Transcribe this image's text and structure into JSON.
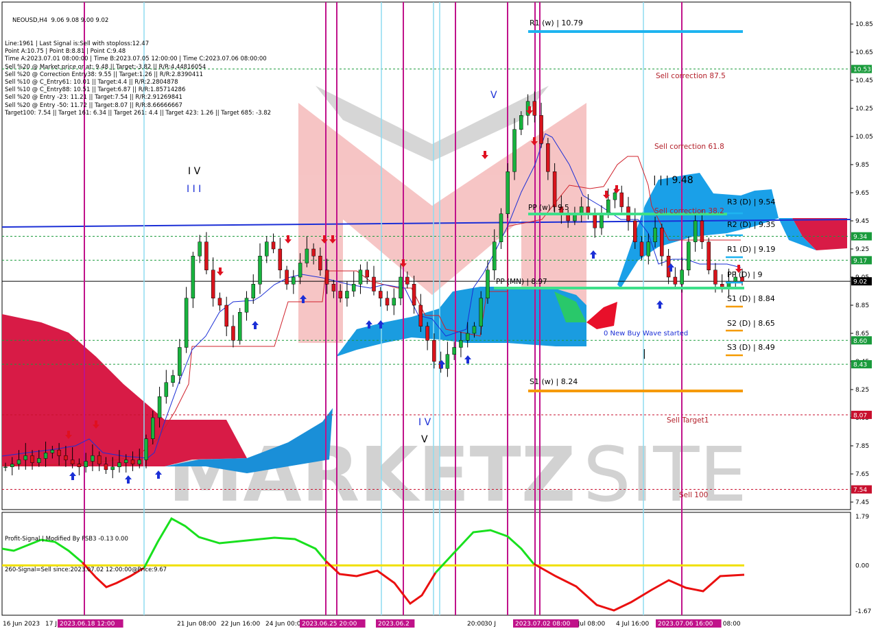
{
  "symbol_header": "NEOUSD,H4  9.06 9.08 9.00 9.02",
  "info_lines": [
    "Line:1961 | Last Signal is:Sell with stoploss:12.47",
    "Point A:10.75 | Point B:8.81 | Point C:9.48",
    "Time A:2023.07.01 08:00:00 | Time B:2023.07.05 12:00:00 | Time C:2023.07.06 08:00:00",
    "Sell %20 @ Market price or at: 9.48 || Target:-3.82 || R/R:4.44816054",
    "Sell %20 @ Correction Entry38: 9.55 || Target:1.26 || R/R:2.8390411",
    "Sell %10 @ C_Entry61: 10.01 || Target:4.4 || R/R:2.2804878",
    "Sell %10 @ C_Entry88: 10.51 || Target:6.87 || R/R:1.85714286",
    "Sell %20 @ Entry -23: 11.21 || Target:7.54 || R/R:2.91269841",
    "Sell %20 @ Entry -50: 11.72 || Target:8.07 || R/R:8.66666667",
    "Target100: 7.54 || Target 161: 6.34 || Target 261: 4.4 || Target 423: 1.26 || Target 685: -3.82"
  ],
  "watermark": "MARKETZ|SITE",
  "levels": [
    {
      "label": "R1 (w) | 10.79",
      "value": 10.79,
      "color": "#1eb4f0"
    },
    {
      "label": "R3 (D) | 9.54",
      "value": 9.54,
      "color": "#1eb4f0"
    },
    {
      "label": "R2 (D) | 9.35",
      "value": 9.35,
      "color": "#1eb4f0"
    },
    {
      "label": "R1 (D) | 9.19",
      "value": 9.19,
      "color": "#1eb4f0"
    },
    {
      "label": "PP (D) | 9",
      "value": 9.0,
      "color": "#1eb4f0"
    },
    {
      "label": "S1 (D) | 8.84",
      "value": 8.84,
      "color": "#f59a00"
    },
    {
      "label": "S2 (D) | 8.65",
      "value": 8.65,
      "color": "#f59a00"
    },
    {
      "label": "S3 (D) | 8.49",
      "value": 8.49,
      "color": "#f59a00"
    },
    {
      "label": "S1 (w) | 8.24",
      "value": 8.24,
      "color": "#f59a00"
    }
  ],
  "annotations": {
    "sell_correction_875": "Sell correction 87.5",
    "sell_correction_618": "Sell correction 61.8",
    "sell_correction_382": "Sell correction 38.2",
    "sell_target1": "Sell Target1",
    "sell_100": "Sell 100",
    "pp_mn": "PP (MN) | 8.97",
    "pp_w": "PP (w) | 9.5",
    "new_buy_wave": "0 New Buy Wave started",
    "wave_iii_value": "| | | 9.48",
    "wave_iv_left": "I V",
    "wave_iii_left": "I I I",
    "wave_iv_mid": "I V",
    "wave_v_mid": "V",
    "wave_v_top": "V",
    "wave_bar": "|"
  },
  "price_axis": {
    "ticks": [
      "10.85",
      "10.65",
      "10.45",
      "10.25",
      "10.05",
      "9.85",
      "9.65",
      "9.45",
      "9.25",
      "9.05",
      "8.85",
      "8.65",
      "8.45",
      "8.25",
      "8.05",
      "7.85",
      "7.65",
      "7.45"
    ],
    "badges": [
      {
        "text": "10.53",
        "value": 10.53,
        "color": "#1a9b3c"
      },
      {
        "text": "9.34",
        "value": 9.34,
        "color": "#1a9b3c"
      },
      {
        "text": "9.17",
        "value": 9.17,
        "color": "#1a9b3c"
      },
      {
        "text": "9.02",
        "value": 9.02,
        "color": "#000000"
      },
      {
        "text": "8.60",
        "value": 8.6,
        "color": "#1a9b3c"
      },
      {
        "text": "8.43",
        "value": 8.43,
        "color": "#1a9b3c"
      },
      {
        "text": "8.07",
        "value": 8.07,
        "color": "#c8102e"
      },
      {
        "text": "7.54",
        "value": 7.54,
        "color": "#c8102e"
      }
    ]
  },
  "time_axis": {
    "labels": [
      "16 Jun 2023",
      "17 J",
      "21 Jun 08:00",
      "22 Jun 16:00",
      "24 Jun 00:00",
      "30 J",
      "3 Jul 08:00",
      "4 Jul 16:00",
      "Jul 08:00",
      "6",
      "20:00"
    ],
    "highlights": [
      "2023.06.18 12:00",
      "2023.06.25 20:00",
      "2023.06.2",
      "2023.07.02 08:00",
      "2023.07.06 16:00"
    ]
  },
  "subwindow": {
    "title": "Profit-Signal | Modified By FSB3 -0.13 0.00",
    "signal_text": "260-Signal=Sell since:2023.07.02 12:00:00@Price:9.67",
    "ticks": [
      "1.79",
      "0.00",
      "-1.67"
    ]
  },
  "chart_data": {
    "type": "candlestick",
    "title": "NEOUSD,H4",
    "ylim": [
      7.4,
      10.95
    ],
    "current_price": 9.02,
    "ohlc_header": {
      "open": 9.06,
      "high": 9.08,
      "low": 9.0,
      "close": 9.02
    },
    "horizontal_levels": {
      "sell_correction_87_5": 10.53,
      "sell_correction_61_8": 10.01,
      "sell_correction_38_2": 9.48,
      "sell_target1": 8.07,
      "sell_100": 7.54,
      "pp_mn": 8.97,
      "pp_w": 9.5
    },
    "indicator": {
      "name": "Profit-Signal",
      "range": [
        -1.67,
        1.79
      ],
      "zero": 0.0
    }
  }
}
